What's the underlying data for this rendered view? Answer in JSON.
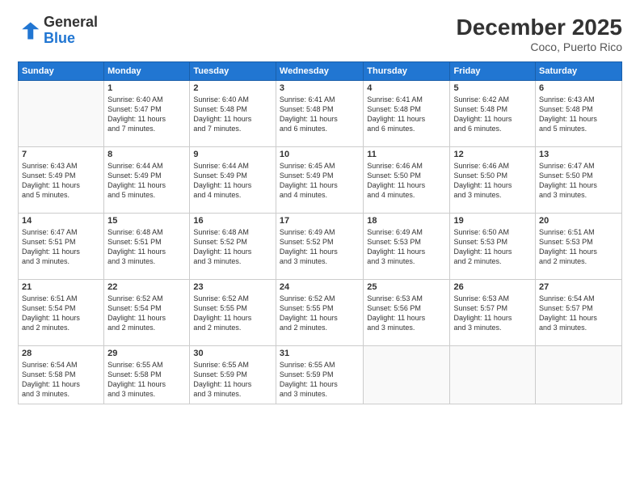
{
  "header": {
    "logo": {
      "line1": "General",
      "line2": "Blue"
    },
    "title": "December 2025",
    "location": "Coco, Puerto Rico"
  },
  "weekdays": [
    "Sunday",
    "Monday",
    "Tuesday",
    "Wednesday",
    "Thursday",
    "Friday",
    "Saturday"
  ],
  "weeks": [
    [
      {
        "day": "",
        "info": ""
      },
      {
        "day": "1",
        "info": "Sunrise: 6:40 AM\nSunset: 5:47 PM\nDaylight: 11 hours\nand 7 minutes."
      },
      {
        "day": "2",
        "info": "Sunrise: 6:40 AM\nSunset: 5:48 PM\nDaylight: 11 hours\nand 7 minutes."
      },
      {
        "day": "3",
        "info": "Sunrise: 6:41 AM\nSunset: 5:48 PM\nDaylight: 11 hours\nand 6 minutes."
      },
      {
        "day": "4",
        "info": "Sunrise: 6:41 AM\nSunset: 5:48 PM\nDaylight: 11 hours\nand 6 minutes."
      },
      {
        "day": "5",
        "info": "Sunrise: 6:42 AM\nSunset: 5:48 PM\nDaylight: 11 hours\nand 6 minutes."
      },
      {
        "day": "6",
        "info": "Sunrise: 6:43 AM\nSunset: 5:48 PM\nDaylight: 11 hours\nand 5 minutes."
      }
    ],
    [
      {
        "day": "7",
        "info": "Sunrise: 6:43 AM\nSunset: 5:49 PM\nDaylight: 11 hours\nand 5 minutes."
      },
      {
        "day": "8",
        "info": "Sunrise: 6:44 AM\nSunset: 5:49 PM\nDaylight: 11 hours\nand 5 minutes."
      },
      {
        "day": "9",
        "info": "Sunrise: 6:44 AM\nSunset: 5:49 PM\nDaylight: 11 hours\nand 4 minutes."
      },
      {
        "day": "10",
        "info": "Sunrise: 6:45 AM\nSunset: 5:49 PM\nDaylight: 11 hours\nand 4 minutes."
      },
      {
        "day": "11",
        "info": "Sunrise: 6:46 AM\nSunset: 5:50 PM\nDaylight: 11 hours\nand 4 minutes."
      },
      {
        "day": "12",
        "info": "Sunrise: 6:46 AM\nSunset: 5:50 PM\nDaylight: 11 hours\nand 3 minutes."
      },
      {
        "day": "13",
        "info": "Sunrise: 6:47 AM\nSunset: 5:50 PM\nDaylight: 11 hours\nand 3 minutes."
      }
    ],
    [
      {
        "day": "14",
        "info": "Sunrise: 6:47 AM\nSunset: 5:51 PM\nDaylight: 11 hours\nand 3 minutes."
      },
      {
        "day": "15",
        "info": "Sunrise: 6:48 AM\nSunset: 5:51 PM\nDaylight: 11 hours\nand 3 minutes."
      },
      {
        "day": "16",
        "info": "Sunrise: 6:48 AM\nSunset: 5:52 PM\nDaylight: 11 hours\nand 3 minutes."
      },
      {
        "day": "17",
        "info": "Sunrise: 6:49 AM\nSunset: 5:52 PM\nDaylight: 11 hours\nand 3 minutes."
      },
      {
        "day": "18",
        "info": "Sunrise: 6:49 AM\nSunset: 5:53 PM\nDaylight: 11 hours\nand 3 minutes."
      },
      {
        "day": "19",
        "info": "Sunrise: 6:50 AM\nSunset: 5:53 PM\nDaylight: 11 hours\nand 2 minutes."
      },
      {
        "day": "20",
        "info": "Sunrise: 6:51 AM\nSunset: 5:53 PM\nDaylight: 11 hours\nand 2 minutes."
      }
    ],
    [
      {
        "day": "21",
        "info": "Sunrise: 6:51 AM\nSunset: 5:54 PM\nDaylight: 11 hours\nand 2 minutes."
      },
      {
        "day": "22",
        "info": "Sunrise: 6:52 AM\nSunset: 5:54 PM\nDaylight: 11 hours\nand 2 minutes."
      },
      {
        "day": "23",
        "info": "Sunrise: 6:52 AM\nSunset: 5:55 PM\nDaylight: 11 hours\nand 2 minutes."
      },
      {
        "day": "24",
        "info": "Sunrise: 6:52 AM\nSunset: 5:55 PM\nDaylight: 11 hours\nand 2 minutes."
      },
      {
        "day": "25",
        "info": "Sunrise: 6:53 AM\nSunset: 5:56 PM\nDaylight: 11 hours\nand 3 minutes."
      },
      {
        "day": "26",
        "info": "Sunrise: 6:53 AM\nSunset: 5:57 PM\nDaylight: 11 hours\nand 3 minutes."
      },
      {
        "day": "27",
        "info": "Sunrise: 6:54 AM\nSunset: 5:57 PM\nDaylight: 11 hours\nand 3 minutes."
      }
    ],
    [
      {
        "day": "28",
        "info": "Sunrise: 6:54 AM\nSunset: 5:58 PM\nDaylight: 11 hours\nand 3 minutes."
      },
      {
        "day": "29",
        "info": "Sunrise: 6:55 AM\nSunset: 5:58 PM\nDaylight: 11 hours\nand 3 minutes."
      },
      {
        "day": "30",
        "info": "Sunrise: 6:55 AM\nSunset: 5:59 PM\nDaylight: 11 hours\nand 3 minutes."
      },
      {
        "day": "31",
        "info": "Sunrise: 6:55 AM\nSunset: 5:59 PM\nDaylight: 11 hours\nand 3 minutes."
      },
      {
        "day": "",
        "info": ""
      },
      {
        "day": "",
        "info": ""
      },
      {
        "day": "",
        "info": ""
      }
    ]
  ]
}
